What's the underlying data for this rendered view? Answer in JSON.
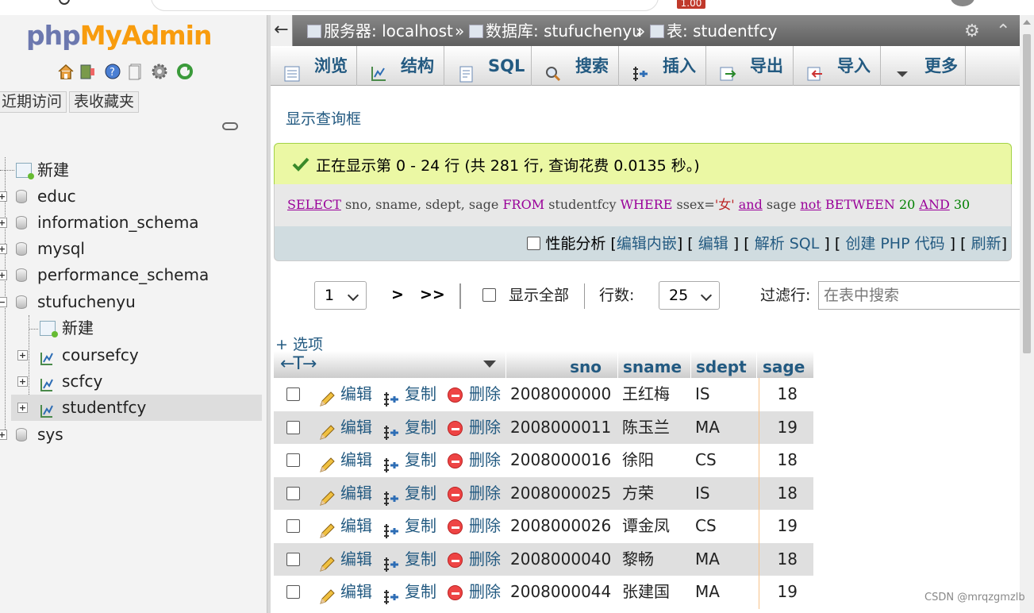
{
  "sidebar": {
    "logo_php": "php",
    "logo_myadmin": "MyAdmin",
    "nav_icons": [
      "home-icon",
      "exit-icon",
      "help-icon",
      "docs-icon",
      "settings-icon",
      "reload-icon"
    ],
    "tabs": [
      "近期访问",
      "表收藏夹"
    ],
    "tree": [
      {
        "label": "新建"
      },
      {
        "label": "educ"
      },
      {
        "label": "information_schema"
      },
      {
        "label": "mysql"
      },
      {
        "label": "performance_schema"
      },
      {
        "label": "stufuchenyu"
      },
      {
        "label": "新建"
      },
      {
        "label": "coursefcy"
      },
      {
        "label": "scfcy"
      },
      {
        "label": "studentfcy"
      },
      {
        "label": "sys"
      }
    ]
  },
  "topbar": {
    "back": "←",
    "server": "服务器: localhost",
    "database": "数据库: stufuchenyu",
    "table": "表: studentfcy",
    "sep": "»"
  },
  "tabs": [
    {
      "label": "浏览",
      "icon": "browse-icon"
    },
    {
      "label": "结构",
      "icon": "structure-icon"
    },
    {
      "label": "SQL",
      "icon": "sql-icon"
    },
    {
      "label": "搜索",
      "icon": "search-icon"
    },
    {
      "label": "插入",
      "icon": "insert-icon"
    },
    {
      "label": "导出",
      "icon": "export-icon"
    },
    {
      "label": "导入",
      "icon": "import-icon"
    },
    {
      "label": "更多",
      "icon": "caret-down-icon"
    }
  ],
  "query": {
    "show_query_link": "显示查询框",
    "success_message": "正在显示第 0 - 24 行 (共 281 行, 查询花费 0.0135 秒。)",
    "sql": {
      "select": "SELECT",
      "cols": " sno, sname, sdept, sage ",
      "from": "FROM",
      "table": " studentfcy ",
      "where": "WHERE",
      "cond": " ssex=",
      "str": "'女'",
      "and1": "and",
      "sage": " sage ",
      "not": "not",
      "between": "BETWEEN",
      "n20": "20",
      "and2": "AND",
      "n30": "30"
    },
    "profiling": "性能分析",
    "links": [
      "编辑内嵌",
      "编辑",
      "解析 SQL",
      "创建 PHP 代码",
      "刷新"
    ]
  },
  "nav": {
    "page": "1",
    "next": ">",
    "last": ">>",
    "show_all": "显示全部",
    "rows_label": "行数:",
    "rows_value": "25",
    "filter_label": "过滤行:",
    "filter_placeholder": "在表中搜索"
  },
  "options_link": "+ 选项",
  "table": {
    "sort_arrows": "←T→",
    "columns": [
      "sno",
      "sname",
      "sdept",
      "sage"
    ],
    "actions": {
      "edit": "编辑",
      "copy": "复制",
      "delete": "删除"
    },
    "rows": [
      {
        "sno": "2008000000",
        "sname": "王红梅",
        "sdept": "IS",
        "sage": "18"
      },
      {
        "sno": "2008000011",
        "sname": "陈玉兰",
        "sdept": "MA",
        "sage": "19"
      },
      {
        "sno": "2008000016",
        "sname": "徐阳",
        "sdept": "CS",
        "sage": "18"
      },
      {
        "sno": "2008000025",
        "sname": "方荣",
        "sdept": "IS",
        "sage": "18"
      },
      {
        "sno": "2008000026",
        "sname": "谭金凤",
        "sdept": "CS",
        "sage": "19"
      },
      {
        "sno": "2008000040",
        "sname": "黎畅",
        "sdept": "MA",
        "sage": "18"
      },
      {
        "sno": "2008000044",
        "sname": "张建国",
        "sdept": "MA",
        "sage": "19"
      }
    ]
  },
  "browser_badge": "1.00",
  "watermark": "CSDN @mrqzgmzlb",
  "colors": {
    "link": "#235a81",
    "success_bg": "#ebf8a4",
    "logo_php": "#6c78af",
    "logo_myadmin": "#f89c0e"
  }
}
